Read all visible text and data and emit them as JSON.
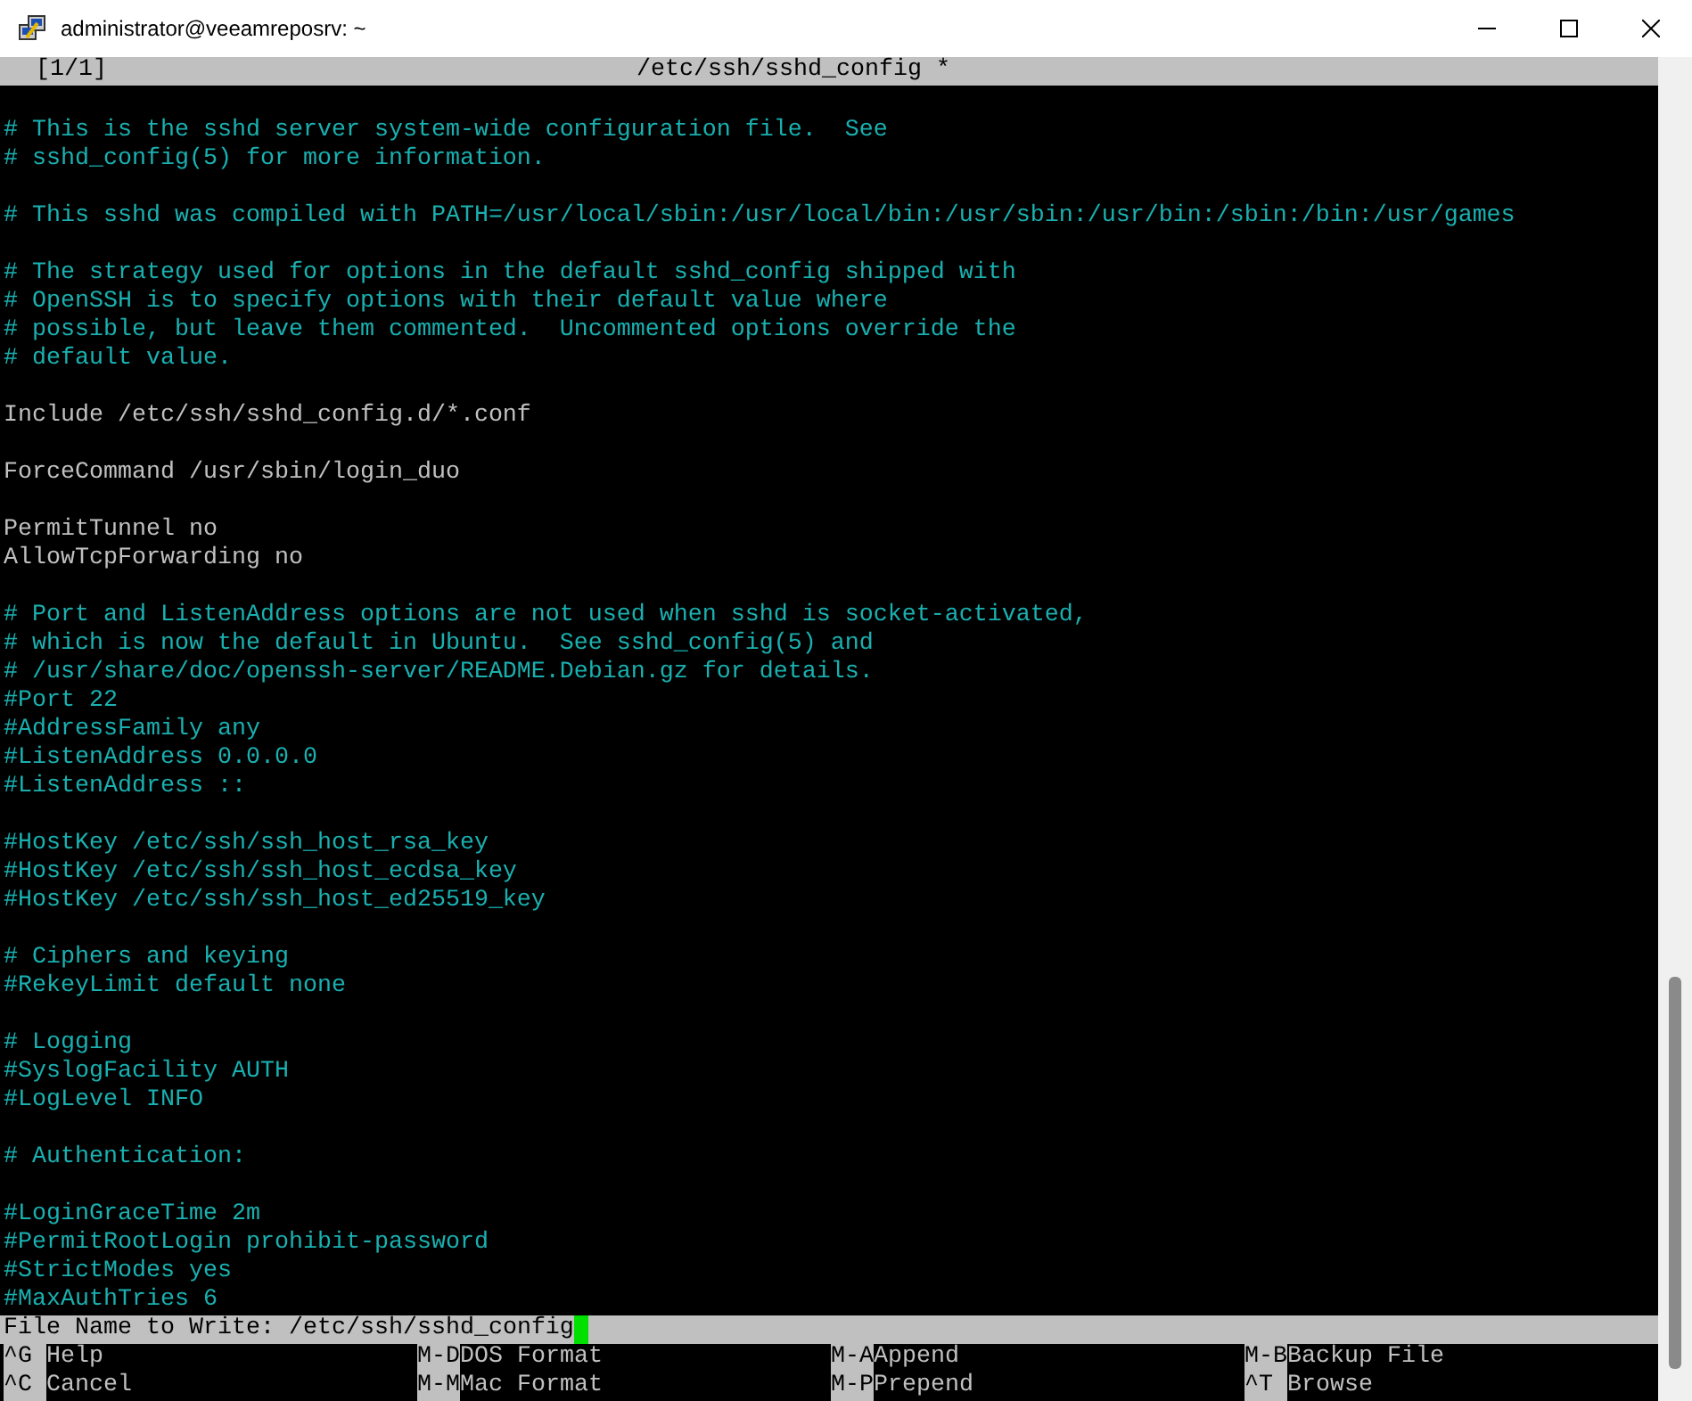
{
  "window": {
    "title": "administrator@veeamreposrv: ~"
  },
  "editor_header": {
    "position": "[1/1]",
    "filename": "/etc/ssh/sshd_config *"
  },
  "lines": [
    {
      "kind": "blank"
    },
    {
      "kind": "comment",
      "text": "# This is the sshd server system-wide configuration file.  See"
    },
    {
      "kind": "comment",
      "text": "# sshd_config(5) for more information."
    },
    {
      "kind": "blank"
    },
    {
      "kind": "comment",
      "text": "# This sshd was compiled with PATH=/usr/local/sbin:/usr/local/bin:/usr/sbin:/usr/bin:/sbin:/bin:/usr/games"
    },
    {
      "kind": "blank"
    },
    {
      "kind": "comment",
      "text": "# The strategy used for options in the default sshd_config shipped with"
    },
    {
      "kind": "comment",
      "text": "# OpenSSH is to specify options with their default value where"
    },
    {
      "kind": "comment",
      "text": "# possible, but leave them commented.  Uncommented options override the"
    },
    {
      "kind": "comment",
      "text": "# default value."
    },
    {
      "kind": "blank"
    },
    {
      "kind": "setting",
      "text": "Include /etc/ssh/sshd_config.d/*.conf"
    },
    {
      "kind": "blank"
    },
    {
      "kind": "setting",
      "text": "ForceCommand /usr/sbin/login_duo"
    },
    {
      "kind": "blank"
    },
    {
      "kind": "setting",
      "text": "PermitTunnel no"
    },
    {
      "kind": "setting",
      "text": "AllowTcpForwarding no"
    },
    {
      "kind": "blank"
    },
    {
      "kind": "comment",
      "text": "# Port and ListenAddress options are not used when sshd is socket-activated,"
    },
    {
      "kind": "comment",
      "text": "# which is now the default in Ubuntu.  See sshd_config(5) and"
    },
    {
      "kind": "comment",
      "text": "# /usr/share/doc/openssh-server/README.Debian.gz for details."
    },
    {
      "kind": "comment",
      "text": "#Port 22"
    },
    {
      "kind": "comment",
      "text": "#AddressFamily any"
    },
    {
      "kind": "comment",
      "text": "#ListenAddress 0.0.0.0"
    },
    {
      "kind": "comment",
      "text": "#ListenAddress ::"
    },
    {
      "kind": "blank"
    },
    {
      "kind": "comment",
      "text": "#HostKey /etc/ssh/ssh_host_rsa_key"
    },
    {
      "kind": "comment",
      "text": "#HostKey /etc/ssh/ssh_host_ecdsa_key"
    },
    {
      "kind": "comment",
      "text": "#HostKey /etc/ssh/ssh_host_ed25519_key"
    },
    {
      "kind": "blank"
    },
    {
      "kind": "comment",
      "text": "# Ciphers and keying"
    },
    {
      "kind": "comment",
      "text": "#RekeyLimit default none"
    },
    {
      "kind": "blank"
    },
    {
      "kind": "comment",
      "text": "# Logging"
    },
    {
      "kind": "comment",
      "text": "#SyslogFacility AUTH"
    },
    {
      "kind": "comment",
      "text": "#LogLevel INFO"
    },
    {
      "kind": "blank"
    },
    {
      "kind": "comment",
      "text": "# Authentication:"
    },
    {
      "kind": "blank"
    },
    {
      "kind": "comment",
      "text": "#LoginGraceTime 2m"
    },
    {
      "kind": "comment",
      "text": "#PermitRootLogin prohibit-password"
    },
    {
      "kind": "comment",
      "text": "#StrictModes yes"
    },
    {
      "kind": "comment",
      "text": "#MaxAuthTries 6"
    }
  ],
  "prompt": {
    "label": "File Name to Write:",
    "value": "/etc/ssh/sshd_config"
  },
  "shortcut_rows": [
    {
      "items": [
        {
          "key": "^G",
          "label": "Help"
        },
        {
          "key": "M-D",
          "label": "DOS Format"
        },
        {
          "key": "M-A",
          "label": "Append"
        },
        {
          "key": "M-B",
          "label": "Backup File"
        }
      ]
    },
    {
      "items": [
        {
          "key": "^C",
          "label": "Cancel"
        },
        {
          "key": "M-M",
          "label": "Mac Format"
        },
        {
          "key": "M-P",
          "label": "Prepend"
        },
        {
          "key": "^T",
          "label": "Browse"
        }
      ]
    }
  ]
}
